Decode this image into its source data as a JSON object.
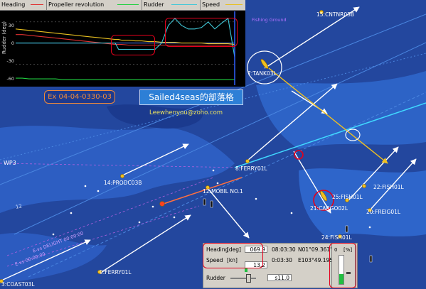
{
  "chart": {
    "legend": [
      {
        "label": "Heading",
        "color": "#e03030"
      },
      {
        "label": "Propeller revolution",
        "color": "#20d040"
      },
      {
        "label": "Rudder",
        "color": "#40c8d8"
      },
      {
        "label": "Speed",
        "color": "#e8c020"
      }
    ],
    "ylabel": "Rudder (deg)",
    "yticks": [
      "30",
      "0",
      "-30",
      "-60"
    ],
    "ylim": [
      -60,
      45
    ],
    "x": [
      0,
      10,
      20,
      30,
      40,
      50,
      60,
      70,
      80,
      90,
      100,
      110,
      120,
      130,
      140,
      150,
      155,
      160,
      170,
      180,
      190,
      200,
      210,
      220,
      230,
      240,
      250,
      260,
      270,
      280,
      290,
      300,
      310,
      320,
      330
    ],
    "series": {
      "rudder": [
        0,
        0,
        0,
        0,
        0,
        0,
        0,
        0,
        0,
        0,
        0,
        0,
        0,
        0,
        0,
        0,
        -9,
        -9,
        -9,
        -9,
        -9,
        -9,
        -9,
        0,
        25,
        35,
        25,
        20,
        20,
        22,
        30,
        20,
        28,
        35,
        -20
      ],
      "heading": [
        12,
        12,
        11,
        10,
        9,
        8,
        7,
        6,
        5,
        4,
        3,
        2,
        1,
        0,
        -1,
        -2,
        -2,
        -2,
        -3,
        -3,
        -3,
        -3,
        -3,
        -3,
        -3,
        -3,
        -3,
        -3,
        -3,
        -3,
        -3,
        -3,
        -3,
        -3,
        -3
      ],
      "speed": [
        20,
        19,
        18,
        17,
        16,
        15,
        14,
        13,
        12,
        11,
        10,
        9,
        8,
        7,
        6,
        5,
        5,
        4,
        4,
        3,
        3,
        2,
        2,
        1,
        1,
        1,
        0,
        0,
        0,
        0,
        -1,
        -1,
        -1,
        -1,
        -2
      ],
      "propeller": [
        -50,
        -50,
        -51,
        -51,
        -51,
        -51,
        -51,
        -52,
        -52,
        -52,
        -52,
        -52,
        -52,
        -52,
        -52,
        -52,
        -52,
        -52,
        -52,
        -52,
        -52,
        -52,
        -52,
        -52,
        -52,
        -52,
        -52,
        -52,
        -52,
        -52,
        -52,
        -52,
        -52,
        -52,
        -52
      ]
    }
  },
  "overlay": {
    "ex_label": "Ex 04-04-0330-03",
    "blog_label": "Sailed4seas的部落格",
    "email": "Leewhenyou@zoho.com"
  },
  "chart_top_label": "Fishing Ground",
  "targets": [
    {
      "id": "t15",
      "label": "15:CNTNR03B"
    },
    {
      "id": "t7",
      "label": "7:TANK03L"
    },
    {
      "id": "t8",
      "label": "8:FERRY01L"
    },
    {
      "id": "t14",
      "label": "14:PRODC03B"
    },
    {
      "id": "t12",
      "label": "12:MOBIL NO.1"
    },
    {
      "id": "t25",
      "label": "25:FISH01L"
    },
    {
      "id": "t21",
      "label": "21:CARGO02L"
    },
    {
      "id": "t22",
      "label": "22:FISH01L"
    },
    {
      "id": "t20",
      "label": "20:FREIG01L"
    },
    {
      "id": "t24",
      "label": "24:FISH01L"
    },
    {
      "id": "t9",
      "label": "9:FERRY01L"
    },
    {
      "id": "t3",
      "label": "3:COAST03L"
    }
  ],
  "map_labels": {
    "wp3": "WP3",
    "depth": "12",
    "track_a": "E-vs DELIGHT 00:00:00",
    "track_b": "E-vs 00:00:00"
  },
  "panel": {
    "heading_label": "Heading",
    "heading_unit": "[deg]",
    "heading_value": "069.9",
    "speed_label": "Speed",
    "speed_unit": "[kn]",
    "speed_value": "13.2",
    "time1": "08:03:30",
    "time2": "0:03:30",
    "lat": "N01°09.361'",
    "lon": "E103°49.195",
    "rudder_label": "Rudder",
    "rudder_value": "s11.0",
    "gauge_top": "0",
    "gauge_unit": "[%]"
  }
}
